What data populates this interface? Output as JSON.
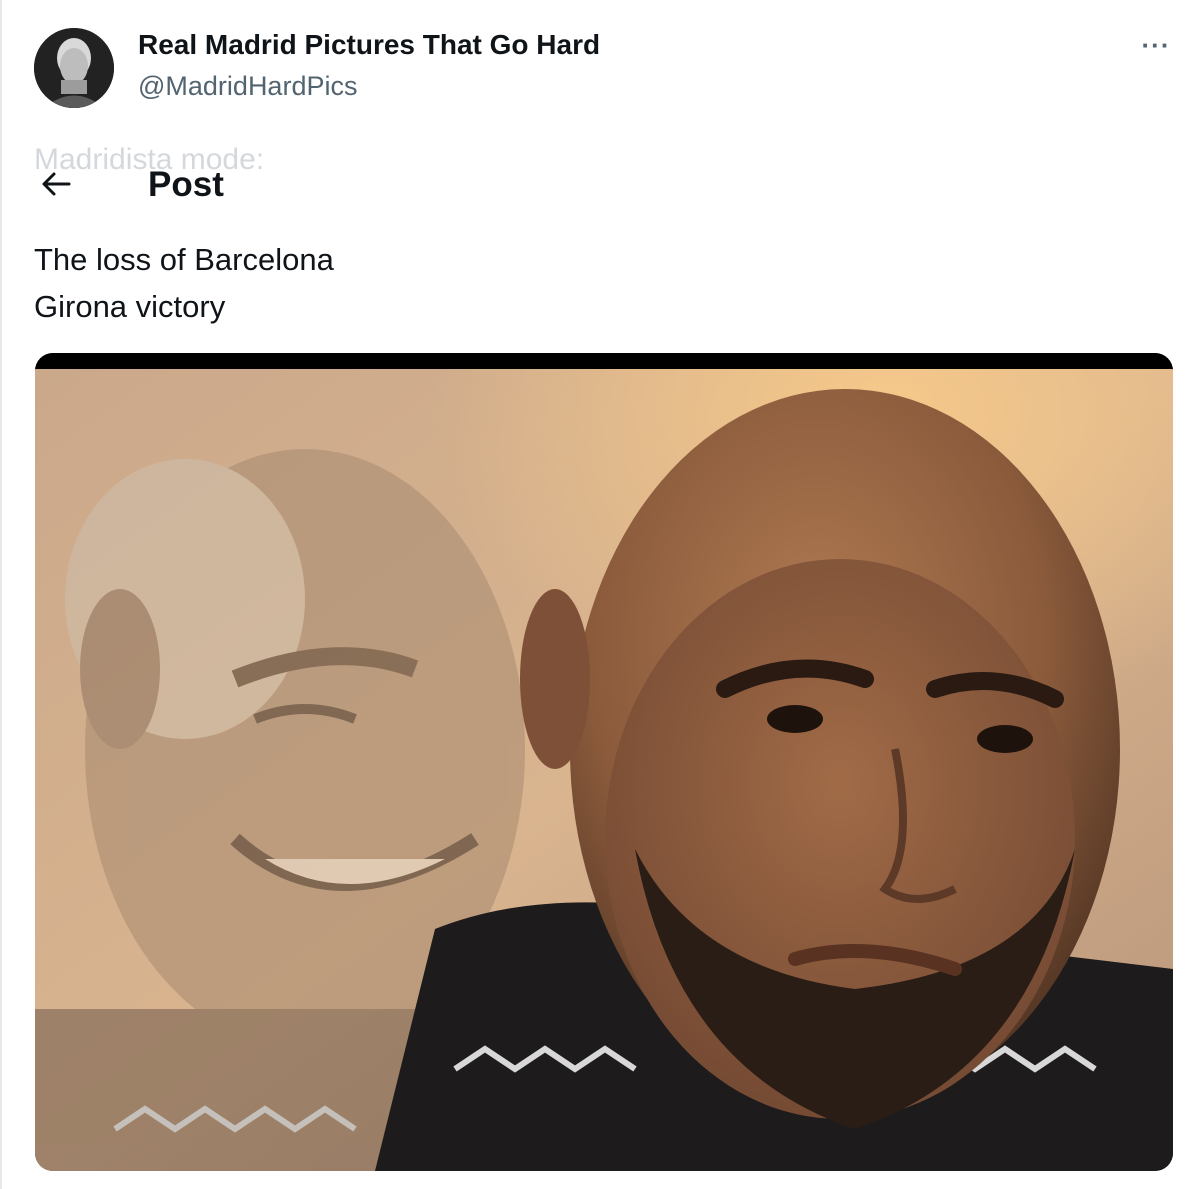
{
  "author": {
    "display_name": "Real Madrid Pictures That Go Hard",
    "handle": "@MadridHardPics",
    "avatar_icon": "profile-photo"
  },
  "header": {
    "ghost_text": "Madridista mode:",
    "back_icon": "arrow-left-icon",
    "title": "Post"
  },
  "more_icon": "more-horizontal-icon",
  "more_label": "···",
  "post": {
    "lines": [
      "The loss of Barcelona",
      "Girona victory"
    ]
  },
  "media": {
    "alt_icon": "meme-photo"
  },
  "colors": {
    "text_primary": "#0f1419",
    "text_secondary": "#536471",
    "ghost": "#d4d8dc"
  }
}
